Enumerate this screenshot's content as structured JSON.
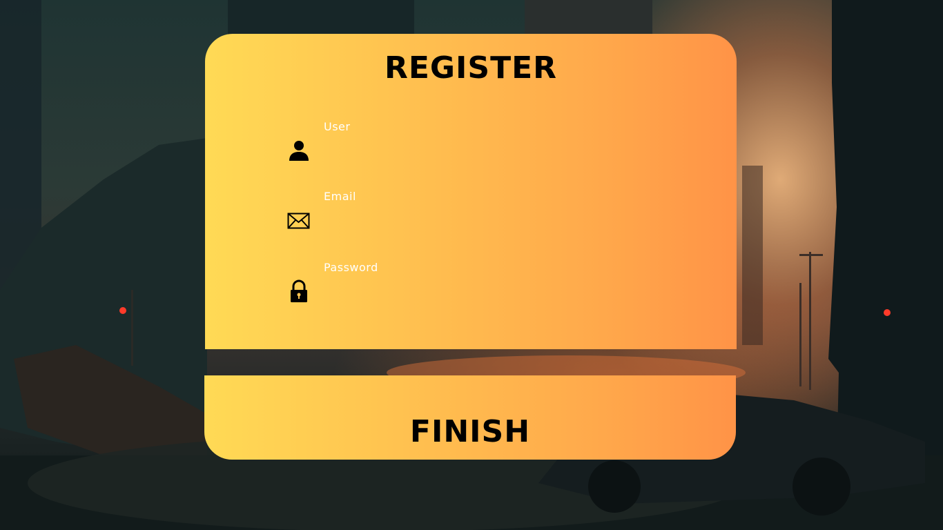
{
  "form": {
    "title": "REGISTER",
    "fields": [
      {
        "label": "User",
        "icon": "user-icon",
        "value": "",
        "type": "text"
      },
      {
        "label": "Email",
        "icon": "envelope-icon",
        "value": "",
        "type": "email"
      },
      {
        "label": "Password",
        "icon": "lock-icon",
        "value": "",
        "type": "password"
      }
    ],
    "submit_label": "FINISH"
  },
  "colors": {
    "gradient_start": "#ffda55",
    "gradient_end": "#ff9347",
    "text": "#000000",
    "label": "#ffffff"
  }
}
